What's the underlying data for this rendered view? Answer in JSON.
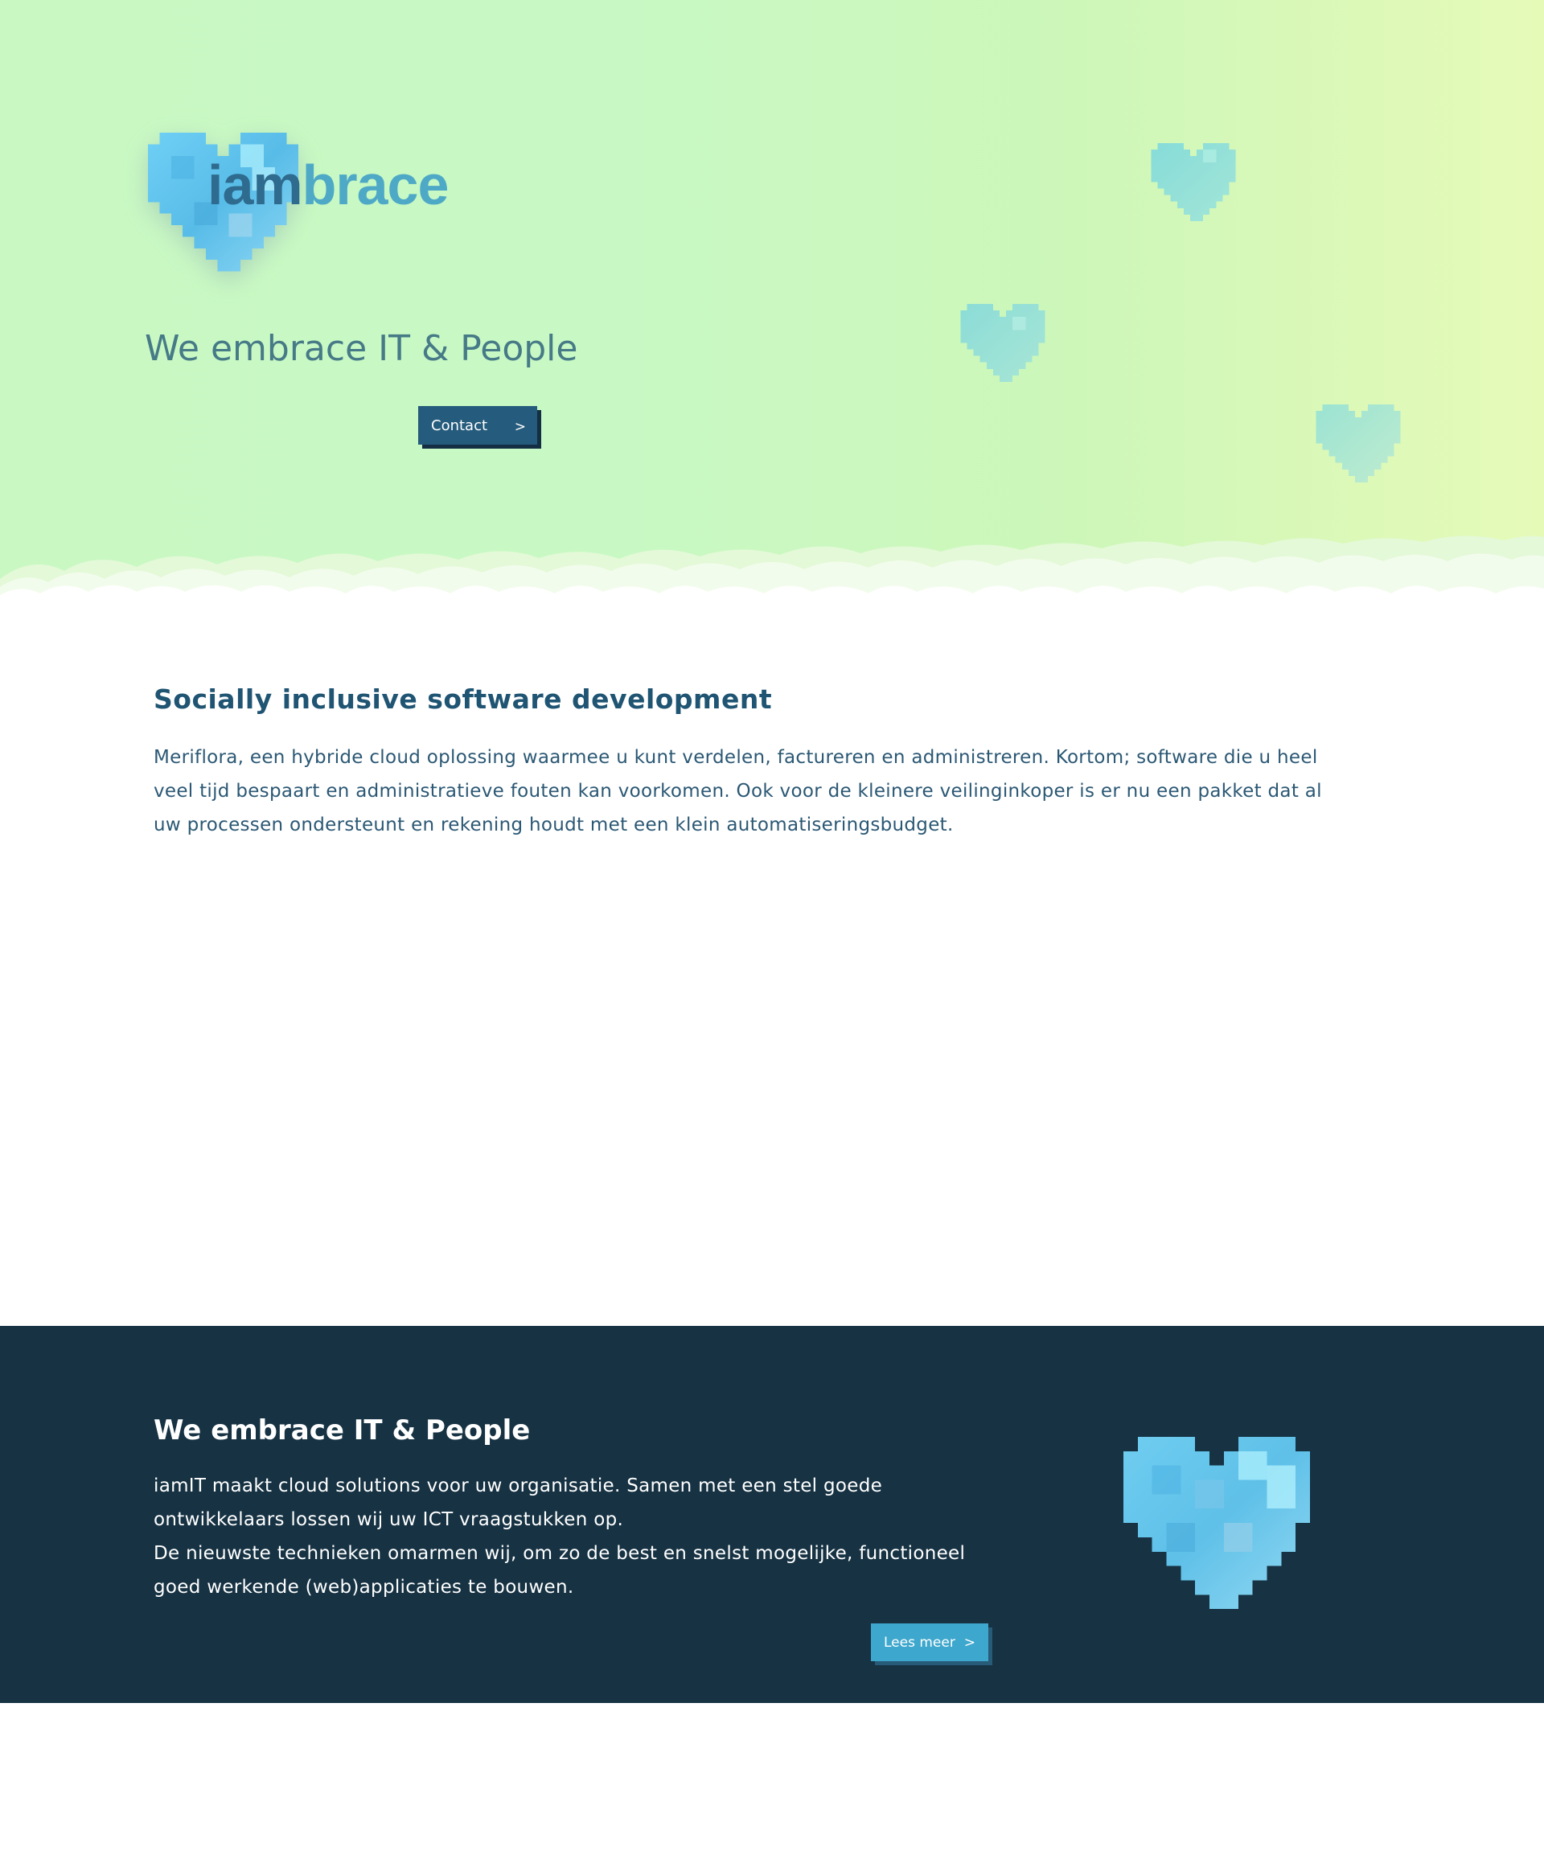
{
  "brand": {
    "logo_part1": "iam",
    "logo_part2": "brace"
  },
  "hero": {
    "title": "We embrace IT & People",
    "contact_label": "Contact",
    "contact_arrow": ">"
  },
  "intro": {
    "heading": "Socially inclusive software development",
    "body": "Meriflora, een hybride cloud oplossing waarmee u kunt verdelen, factureren en administreren. Kortom; software die u heel veel tijd bespaart en administratieve fouten kan voorkomen. Ook voor de kleinere veilinginkoper is er nu een pakket dat al uw processen ondersteunt en rekening houdt met een klein automatiseringsbudget."
  },
  "about": {
    "heading": "We embrace IT & People",
    "line1": "iamIT maakt cloud solutions voor uw organisatie. Samen met een stel goede ontwikkelaars lossen wij uw ICT vraagstukken op.",
    "line2": "De nieuwste technieken omarmen wij, om zo de best en snelst mogelijke, functioneel goed werkende (web)applicaties te bouwen.",
    "more_label": "Lees meer",
    "more_arrow": ">"
  },
  "icons": {
    "logo": "pixel-heart-icon",
    "decor": "pixel-heart-icon",
    "band": "pixel-heart-icon"
  },
  "colors": {
    "hero_bg": "#c9f8c3",
    "navy": "#163243",
    "button_dark": "#255b7c",
    "button_light": "#3ea7cd",
    "heading_blue": "#1f5473"
  }
}
